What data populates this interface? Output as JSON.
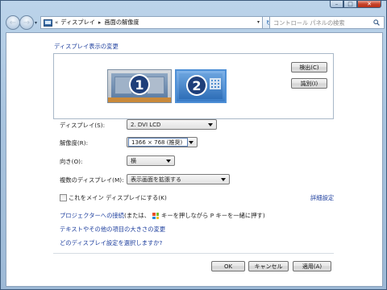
{
  "window": {
    "minimize_glyph": "–",
    "maximize_glyph": "□",
    "close_glyph": "✕"
  },
  "nav": {
    "back_glyph": "←",
    "forward_glyph": "→",
    "dropdown_glyph": "▾",
    "refresh_glyph": "↻"
  },
  "address": {
    "prefix_chevrons": "«",
    "crumbs": [
      "ディスプレイ",
      "画面の解像度"
    ],
    "separator": "▸",
    "dropdown_glyph": "▾"
  },
  "search": {
    "placeholder": "コントロール パネルの検索",
    "icon": "search-icon"
  },
  "main": {
    "heading": "ディスプレイ表示の変更",
    "monitors": [
      {
        "number": "1",
        "selected": false
      },
      {
        "number": "2",
        "selected": true
      }
    ],
    "detect_label": "検出(C)",
    "identify_label": "識別(I)"
  },
  "form": {
    "display_label": "ディスプレイ(S):",
    "display_value": "2. DVI LCD",
    "resolution_label": "解像度(R):",
    "resolution_value": "1366 × 768 (推奨)",
    "orientation_label": "向き(O):",
    "orientation_value": "横",
    "multi_label": "複数のディスプレイ(M):",
    "multi_value": "表示画面を拡張する"
  },
  "options": {
    "main_display_label": "これをメイン ディスプレイにする(K)",
    "main_display_checked": false,
    "advanced_link": "詳細設定"
  },
  "links": {
    "projector_link": "プロジェクターへの接続",
    "projector_tip_prefix": " (または、",
    "projector_tip_suffix": " キーを押しながら P キーを一緒に押す)",
    "text_size_link": "テキストやその他の項目の大きさの変更",
    "which_settings_link": "どのディスプレイ設定を選択しますか?"
  },
  "footer": {
    "ok_label": "OK",
    "cancel_label": "キャンセル",
    "apply_label": "適用(A)"
  },
  "colors": {
    "link": "#1e3f9e",
    "selected_monitor": "#4d8fd6",
    "close_button": "#c7432a"
  }
}
